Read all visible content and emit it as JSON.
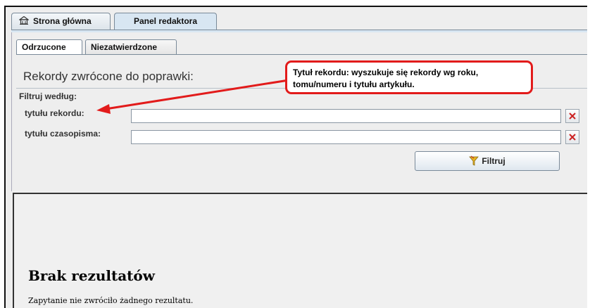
{
  "top_tabs": [
    {
      "label": "Strona główna",
      "icon": "home-icon",
      "active": false
    },
    {
      "label": "Panel redaktora",
      "active": true
    }
  ],
  "sub_tabs": [
    {
      "label": "Odrzucone",
      "active": true
    },
    {
      "label": "Niezatwierdzone",
      "active": false
    }
  ],
  "panel": {
    "heading": "Rekordy zwrócone do poprawki:",
    "filter_label": "Filtruj według:",
    "fields": [
      {
        "label": "tytułu rekordu:",
        "value": ""
      },
      {
        "label": "tytułu czasopisma:",
        "value": ""
      }
    ],
    "filter_button": "Filtruj"
  },
  "results": {
    "title": "Brak rezultatów",
    "message": "Zapytanie nie zwróciło żadnego rezultatu."
  },
  "callout": {
    "line1": "Tytuł rekordu: wyszukuje się rekordy wg roku,",
    "line2": "tomu/numeru i tytułu artykułu."
  },
  "colors": {
    "annotation_red": "#e21b1b",
    "active_tab_bg": "#d8e6f2",
    "clear_icon_red": "#cc2222"
  }
}
